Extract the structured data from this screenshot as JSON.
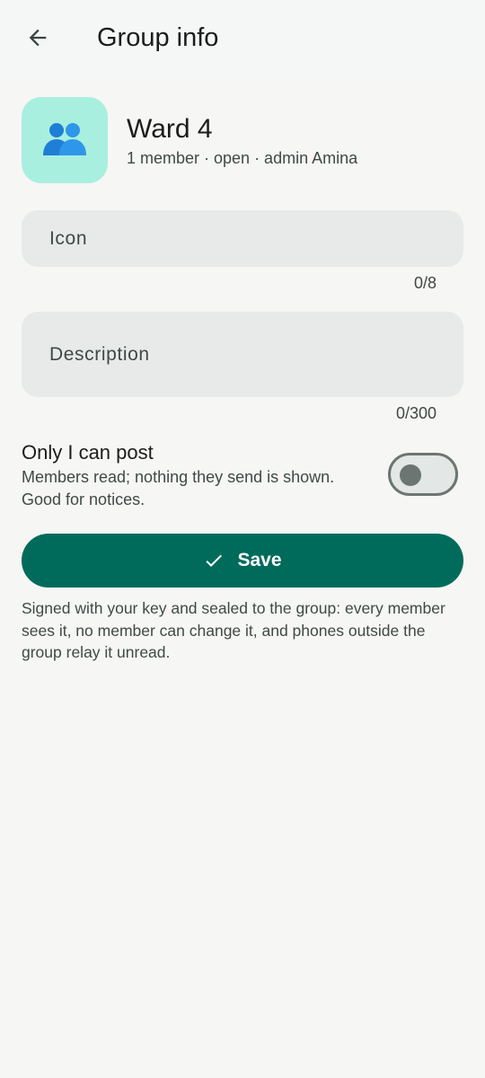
{
  "app_bar": {
    "back_icon": "arrow-left-icon",
    "title": "Group info"
  },
  "group": {
    "avatar_icon": "people-icon",
    "name": "Ward 4",
    "meta": "1 member · open · admin Amina"
  },
  "fields": {
    "icon": {
      "placeholder": "Icon",
      "value": "",
      "counter": "0/8"
    },
    "description": {
      "placeholder": "Description",
      "value": "",
      "counter": "0/300"
    }
  },
  "only_i_can_post": {
    "label": "Only I can post",
    "description": "Members read; nothing they send is shown. Good for notices.",
    "enabled": false
  },
  "save_button": {
    "icon": "check-icon",
    "label": "Save"
  },
  "footnote": "Signed with your key and sealed to the group: every member sees it, no member can change it, and phones outside the group relay it unread.",
  "colors": {
    "primary": "#006b5b",
    "avatar_bg": "#a8efdf",
    "field_bg": "#e7eae9",
    "page_bg": "#f6f6f4"
  }
}
